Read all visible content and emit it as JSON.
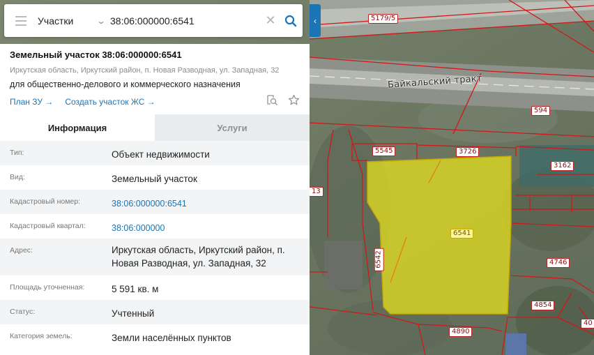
{
  "search": {
    "category": "Участки",
    "query": "38:06:000000:6541",
    "clear_glyph": "✕"
  },
  "collapse_glyph": "‹",
  "card": {
    "title": "Земельный участок 38:06:000000:6541",
    "address": "Иркутская область, Иркутский район, п. Новая Разводная, ул. Западная, 32",
    "purpose": "для общественно-делового и коммерческого назначения",
    "link_plan": "План ЗУ →",
    "link_create": "Создать участок ЖС →"
  },
  "tabs": [
    {
      "label": "Информация"
    },
    {
      "label": "Услуги"
    }
  ],
  "info": [
    {
      "key": "Тип:",
      "value": "Объект недвижимости"
    },
    {
      "key": "Вид:",
      "value": "Земельный участок"
    },
    {
      "key": "Кадастровый номер:",
      "value": "38:06:000000:6541"
    },
    {
      "key": "Кадастровый квартал:",
      "value": "38:06:000000"
    },
    {
      "key": "Адрес:",
      "value": "Иркутская область, Иркутский район, п. Новая Разводная, ул. Западная, 32"
    },
    {
      "key": "Площадь уточненная:",
      "value": "5 591 кв. м"
    },
    {
      "key": "Статус:",
      "value": "Учтенный"
    },
    {
      "key": "Категория земель:",
      "value": "Земли населённых пунктов"
    }
  ],
  "map": {
    "road_name": "Байкальский тракт",
    "labels": {
      "p5179": "5179/5",
      "p594": "594",
      "p5545": "5545",
      "p3726": "3726",
      "p3162": "3162",
      "p13": "13",
      "p6541": "6541",
      "p6542": "6542",
      "p4746": "4746",
      "p4854": "4854",
      "p4890": "4890",
      "p40": "40"
    }
  },
  "colors": {
    "accent": "#1b74b6",
    "boundary": "#d01818",
    "selected_fill": "#e6e01e"
  },
  "icons": [
    "menu-icon",
    "chevron-down-icon",
    "close-icon",
    "search-icon",
    "collapse-chevron-icon",
    "zoom-to-icon",
    "star-icon"
  ]
}
